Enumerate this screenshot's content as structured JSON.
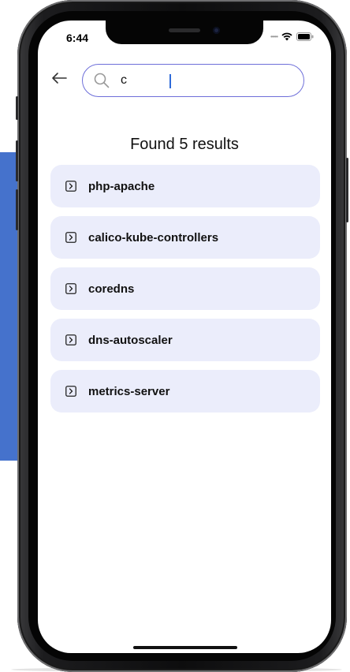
{
  "status_bar": {
    "time": "6:44",
    "signal_icon": "signal-dots-icon",
    "wifi_icon": "wifi-icon",
    "battery_icon": "battery-icon"
  },
  "search": {
    "back_icon": "arrow-left-icon",
    "search_icon": "search-icon",
    "value": "c",
    "accent_color": "#6e6fd9"
  },
  "results": {
    "title": "Found 5 results",
    "item_icon": "chevron-right-box-icon",
    "item_background": "#ebedfb",
    "items": [
      {
        "label": "php-apache"
      },
      {
        "label": "calico-kube-controllers"
      },
      {
        "label": "coredns"
      },
      {
        "label": "dns-autoscaler"
      },
      {
        "label": "metrics-server"
      }
    ]
  },
  "colors": {
    "background_panel": "#4572cc",
    "caret": "#2f6bd9"
  }
}
